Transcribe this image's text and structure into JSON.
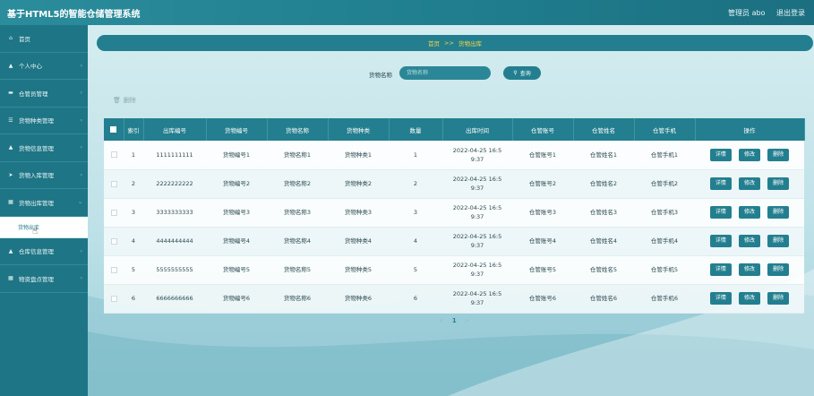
{
  "header": {
    "title": "基于HTML5的智能仓储管理系统",
    "user_label": "管理员 abo",
    "logout_label": "退出登录"
  },
  "sidebar": {
    "items": [
      {
        "label": "首页",
        "icon": "home-icon"
      },
      {
        "label": "个人中心",
        "icon": "user-icon"
      },
      {
        "label": "仓管员管理",
        "icon": "briefcase-icon"
      },
      {
        "label": "货物种类管理",
        "icon": "list-icon"
      },
      {
        "label": "货物信息管理",
        "icon": "user-icon"
      },
      {
        "label": "货物入库管理",
        "icon": "send-icon"
      },
      {
        "label": "货物出库管理",
        "icon": "grid-icon"
      }
    ],
    "active_sub": "货物出库",
    "items_after": [
      {
        "label": "仓库信息管理",
        "icon": "user-icon"
      },
      {
        "label": "物资盘点管理",
        "icon": "grid-icon"
      }
    ]
  },
  "breadcrumb": {
    "home": "首页",
    "separator": ">>",
    "current": "货物出库"
  },
  "search": {
    "label": "货物名称",
    "placeholder": "货物名称",
    "button_label": "查询"
  },
  "toolbar": {
    "delete_label": "删除"
  },
  "table": {
    "columns": [
      "索引",
      "出库编号",
      "货物编号",
      "货物名称",
      "货物种类",
      "数量",
      "出库时间",
      "仓管账号",
      "仓管姓名",
      "仓管手机",
      "操作"
    ],
    "actions": {
      "detail": "详情",
      "edit": "修改",
      "delete": "删除"
    },
    "rows": [
      {
        "index": "1",
        "out_no": "1111111111",
        "goods_no": "货物编号1",
        "goods_name": "货物名称1",
        "goods_type": "货物种类1",
        "qty": "1",
        "time_date": "2022-04-25 16:5",
        "time_clock": "9:37",
        "account": "仓管账号1",
        "name": "仓管姓名1",
        "phone": "仓管手机1"
      },
      {
        "index": "2",
        "out_no": "2222222222",
        "goods_no": "货物编号2",
        "goods_name": "货物名称2",
        "goods_type": "货物种类2",
        "qty": "2",
        "time_date": "2022-04-25 16:5",
        "time_clock": "9:37",
        "account": "仓管账号2",
        "name": "仓管姓名2",
        "phone": "仓管手机2"
      },
      {
        "index": "3",
        "out_no": "3333333333",
        "goods_no": "货物编号3",
        "goods_name": "货物名称3",
        "goods_type": "货物种类3",
        "qty": "3",
        "time_date": "2022-04-25 16:5",
        "time_clock": "9:37",
        "account": "仓管账号3",
        "name": "仓管姓名3",
        "phone": "仓管手机3"
      },
      {
        "index": "4",
        "out_no": "4444444444",
        "goods_no": "货物编号4",
        "goods_name": "货物名称4",
        "goods_type": "货物种类4",
        "qty": "4",
        "time_date": "2022-04-25 16:5",
        "time_clock": "9:37",
        "account": "仓管账号4",
        "name": "仓管姓名4",
        "phone": "仓管手机4"
      },
      {
        "index": "5",
        "out_no": "5555555555",
        "goods_no": "货物编号5",
        "goods_name": "货物名称5",
        "goods_type": "货物种类5",
        "qty": "5",
        "time_date": "2022-04-25 16:5",
        "time_clock": "9:37",
        "account": "仓管账号5",
        "name": "仓管姓名5",
        "phone": "仓管手机5"
      },
      {
        "index": "6",
        "out_no": "6666666666",
        "goods_no": "货物编号6",
        "goods_name": "货物名称6",
        "goods_type": "货物种类6",
        "qty": "6",
        "time_date": "2022-04-25 16:5",
        "time_clock": "9:37",
        "account": "仓管账号6",
        "name": "仓管姓名6",
        "phone": "仓管手机6"
      }
    ]
  },
  "pagination": {
    "prev": "<",
    "current": "1",
    "next": ">"
  },
  "colors": {
    "primary": "#237f8f",
    "sidebar": "#1e7585",
    "breadcrumb_text": "#f5d24a"
  }
}
